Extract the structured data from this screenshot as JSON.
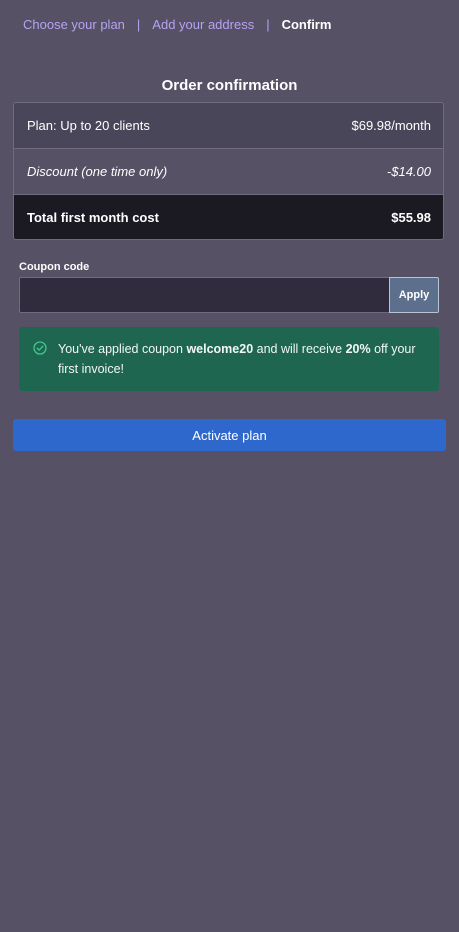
{
  "breadcrumb": {
    "step1": "Choose your plan",
    "step2": "Add your address",
    "step3": "Confirm",
    "separator": "|"
  },
  "title": "Order confirmation",
  "summary": {
    "plan_label": "Plan: Up to 20 clients",
    "plan_price": "$69.98/month",
    "discount_label": "Discount (one time only)",
    "discount_value": "-$14.00",
    "total_label": "Total first month cost",
    "total_value": "$55.98"
  },
  "coupon": {
    "label": "Coupon code",
    "value": "",
    "apply_label": "Apply"
  },
  "alert": {
    "icon": "check-circle-icon",
    "text_1": "You've applied coupon ",
    "code": "welcome20",
    "text_2": " and will receive ",
    "percent": "20%",
    "text_3": " off your first invoice!"
  },
  "activate_label": "Activate plan",
  "colors": {
    "background": "#565165",
    "link": "#b6a3f4",
    "success": "#1f6650",
    "primary": "#2f68cd"
  }
}
